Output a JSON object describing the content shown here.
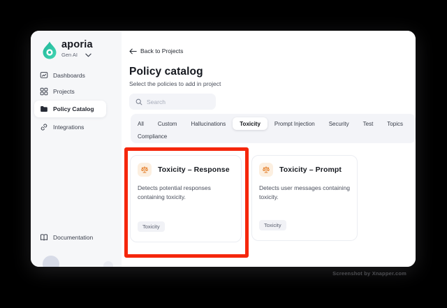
{
  "sidebar": {
    "logo_text": "aporia",
    "workspace": "Gen AI",
    "items": [
      {
        "label": "Dashboards",
        "icon": "dashboard-icon",
        "active": false
      },
      {
        "label": "Projects",
        "icon": "grid-icon",
        "active": false
      },
      {
        "label": "Policy Catalog",
        "icon": "folder-icon",
        "active": true
      },
      {
        "label": "Integrations",
        "icon": "link-icon",
        "active": false
      }
    ],
    "footer": {
      "label": "Documentation",
      "icon": "book-icon"
    }
  },
  "main": {
    "back_label": "Back to Projects",
    "title": "Policy catalog",
    "subtitle": "Select the policies to add in project",
    "search_placeholder": "Search",
    "tabs": [
      {
        "label": "All",
        "active": false
      },
      {
        "label": "Custom",
        "active": false
      },
      {
        "label": "Hallucinations",
        "active": false
      },
      {
        "label": "Toxicity",
        "active": true
      },
      {
        "label": "Prompt Injection",
        "active": false
      },
      {
        "label": "Security",
        "active": false
      },
      {
        "label": "Test",
        "active": false
      },
      {
        "label": "Topics",
        "active": false
      },
      {
        "label": "Compliance",
        "active": false
      }
    ],
    "cards": [
      {
        "title": "Toxicity – Response",
        "description": "Detects potential responses containing toxicity.",
        "tag": "Toxicity",
        "icon": "scales-icon",
        "highlighted": true
      },
      {
        "title": "Toxicity – Prompt",
        "description": "Detects user messages containing toxicity.",
        "tag": "Toxicity",
        "icon": "scales-icon",
        "highlighted": false
      }
    ]
  },
  "watermark": "Screenshot by Xnapper.com",
  "colors": {
    "brand_teal": "#2CC3A7",
    "icon_orange": "#E5822F",
    "icon_orange_bg": "#FCEFE0",
    "highlight_red": "#F5270C",
    "sidebar_bg": "#F6F7F9",
    "chip_bg": "#F1F2F6"
  }
}
